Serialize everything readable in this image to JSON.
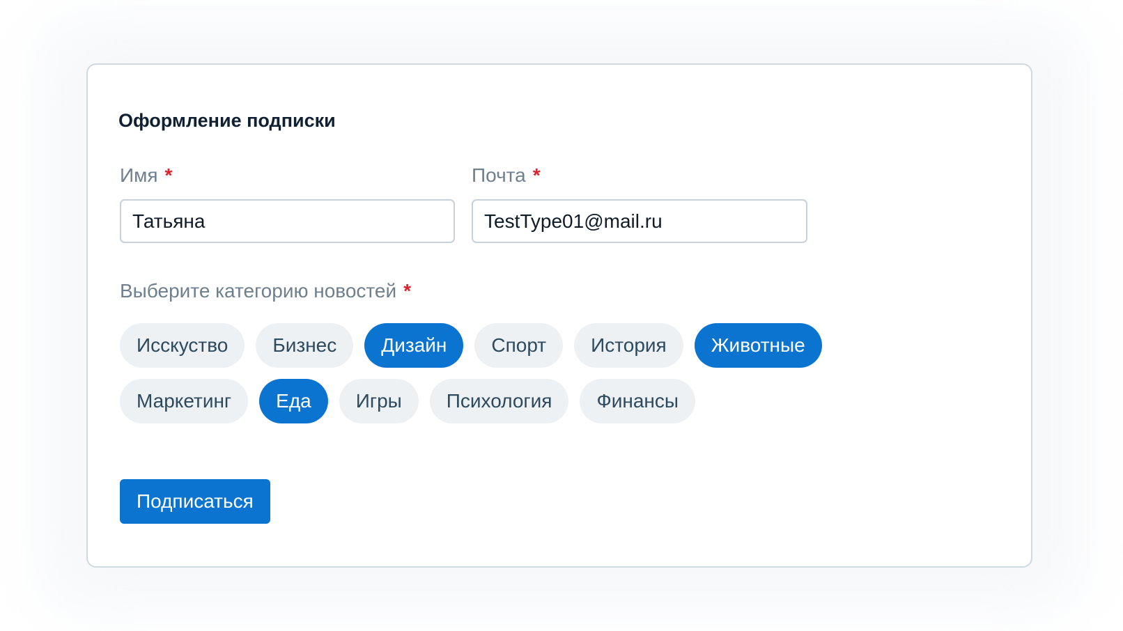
{
  "form": {
    "title": "Оформление подписки",
    "required_mark": "*",
    "name": {
      "label": "Имя",
      "value": "Татьяна"
    },
    "email": {
      "label": "Почта",
      "value": "TestType01@mail.ru"
    },
    "categories_label": "Выберите категорию новостей",
    "categories": [
      {
        "label": "Исскуство",
        "selected": false
      },
      {
        "label": "Бизнес",
        "selected": false
      },
      {
        "label": "Дизайн",
        "selected": true
      },
      {
        "label": "Спорт",
        "selected": false
      },
      {
        "label": "История",
        "selected": false
      },
      {
        "label": "Животные",
        "selected": true
      },
      {
        "label": "Маркетинг",
        "selected": false
      },
      {
        "label": "Еда",
        "selected": true
      },
      {
        "label": "Игры",
        "selected": false
      },
      {
        "label": "Психология",
        "selected": false
      },
      {
        "label": "Финансы",
        "selected": false
      }
    ],
    "submit_label": "Подписаться"
  },
  "colors": {
    "accent": "#0b74d1",
    "chip_bg": "#edf1f4",
    "required": "#d9232f",
    "border": "#cfd9e2"
  }
}
